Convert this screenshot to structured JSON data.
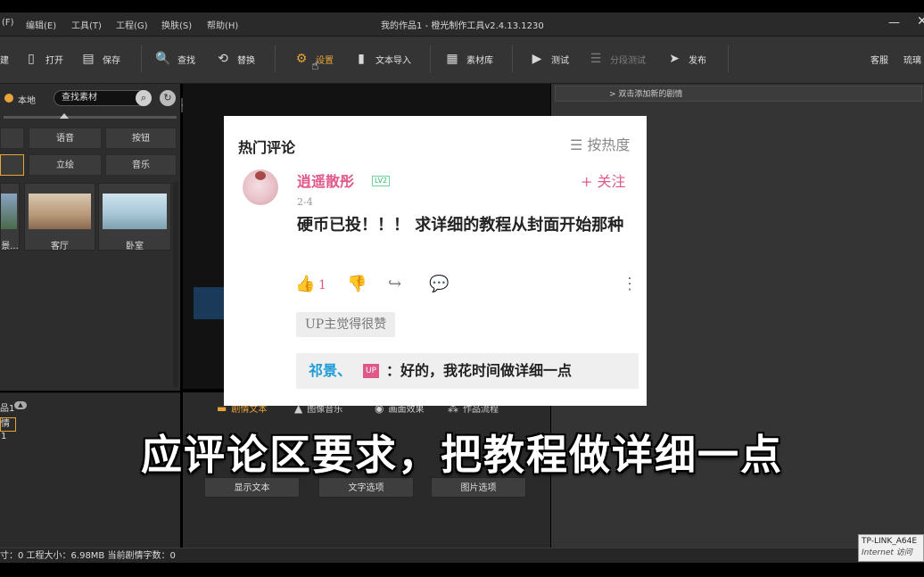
{
  "window": {
    "title": "我的作品1 - 橙光制作工具v2.4.13.1230",
    "minimize": "—",
    "close": "✕"
  },
  "menu": [
    "(F)",
    "编辑(E)",
    "工具(T)",
    "工程(G)",
    "换肤(S)",
    "帮助(H)"
  ],
  "toolbar": {
    "new": "建",
    "open": "打开",
    "save": "保存",
    "find": "查找",
    "replace": "替换",
    "settings": "设置",
    "text_import": "文本导入",
    "asset_lib": "素材库",
    "test": "测试",
    "segment_test": "分段测试",
    "publish": "发布",
    "service": "客服",
    "stream": "琉璃"
  },
  "asset_panel": {
    "local_label": "本地",
    "search_placeholder": "查找素材",
    "categories_row1": [
      "",
      "语音",
      "按钮"
    ],
    "categories_row2": [
      "",
      "立绘",
      "音乐"
    ],
    "thumbnails": [
      {
        "label": "景..."
      },
      {
        "label": "客厅"
      },
      {
        "label": "卧室"
      }
    ]
  },
  "scene_panel": {
    "label": "品1",
    "item": "情1"
  },
  "bottom_tabs": {
    "tabs": [
      "剧情文本",
      "图像音乐",
      "画面效果",
      "作品流程"
    ],
    "buttons": [
      "显示文本",
      "文字选项",
      "图片选项"
    ]
  },
  "right_panel": {
    "add_scene": "> 双击添加新的剧情"
  },
  "status": {
    "text": "寸：0  工程大小：6.98MB  当前剧情字数：0"
  },
  "tray": {
    "line1": "TP-LINK_A64E",
    "line2": "Internet 访问"
  },
  "comment": {
    "title": "热门评论",
    "sort": "☰ 按热度",
    "user": "逍遥散彤",
    "level": "LV2",
    "follow": "+ 关注",
    "date": "2-4",
    "body": "硬币已投！！！ 求详细的教程从封面开始那种",
    "like_count": "1",
    "up_badge": "UP主觉得很赞",
    "reply_user": "祁景、",
    "up_tag": "UP",
    "reply_text": "：好的，我花时间做详细一点"
  },
  "subtitle": "应评论区要求，把教程做详细一点",
  "colors": {
    "accent": "#e8a33a",
    "pink": "#e0588a",
    "reply_blue": "#1b9bd6"
  }
}
